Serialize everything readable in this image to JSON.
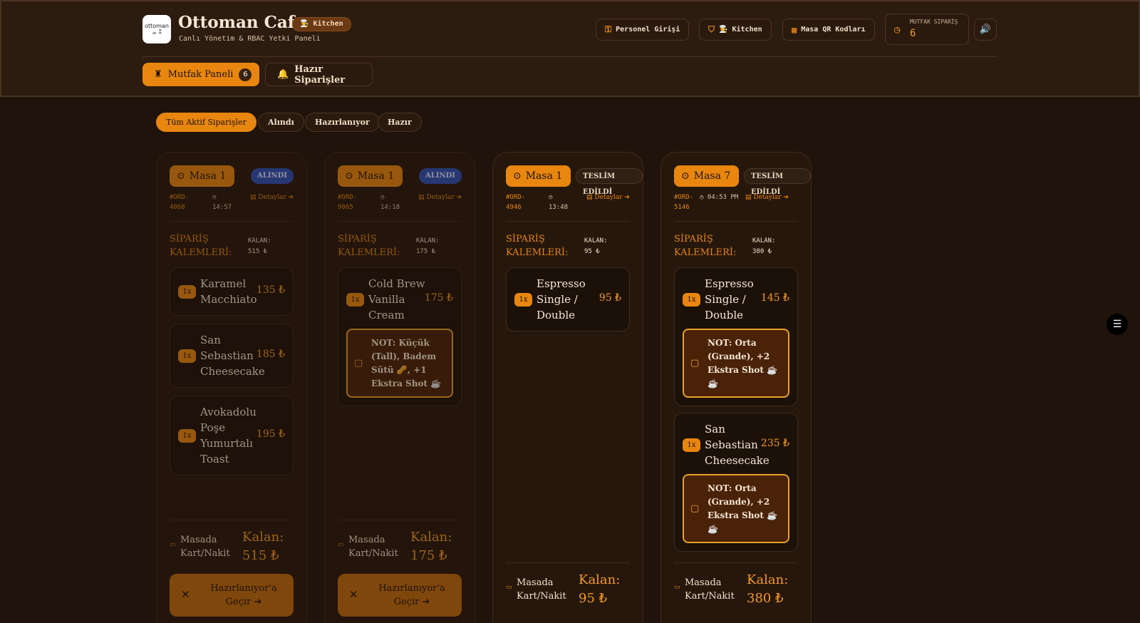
{
  "header": {
    "logo_text_top": "ottoman",
    "logo_text_bottom": "☕ ⁑",
    "app_title": "Ottoman Cafe",
    "role_badge": "👩‍🍳 Kitchen",
    "subtitle": "Canlı Yönetim & RBAC Yetki Paneli",
    "buttons": {
      "staff_login": "Personel Girişi",
      "kitchen": "👩‍🍳 Kitchen",
      "qr_codes": "Masa QR Kodları"
    },
    "counter": {
      "label": "MUTFAK SİPARİŞ",
      "value": "6"
    }
  },
  "tabs": {
    "kitchen_panel": "Mutfak Paneli",
    "kitchen_count": "6",
    "ready_orders": "Hazır Siparişler"
  },
  "filters": [
    "Tüm Aktif Siparişler",
    "Alındı",
    "Hazırlanıyor",
    "Hazır"
  ],
  "labels": {
    "items_title": "SİPARİŞ KALEMLERİ:",
    "kalan_small": "KALAN:",
    "pay_method": "Masada Kart/Nakit",
    "kalan_big": "Kalan:",
    "details": "Detaylar ➔"
  },
  "orders": [
    {
      "table": "Masa 1",
      "status": "ALINDI",
      "order_id_1": "#ORD-",
      "order_id_2": "4068",
      "time": "14:57",
      "remaining": "515 ₺",
      "items": [
        {
          "qty": "1x",
          "name": "Karamel Macchiato",
          "price": "135 ₺"
        },
        {
          "qty": "1x",
          "name": "San Sebastian Cheesecake",
          "price": "185 ₺"
        },
        {
          "qty": "1x",
          "name": "Avokadolu Poşe Yumurtalı Toast",
          "price": "195 ₺"
        }
      ],
      "action": "Hazırlanıyor'a Geçir ➔"
    },
    {
      "table": "Masa 1",
      "status": "ALINDI",
      "order_id_1": "#ORD-",
      "order_id_2": "9065",
      "time": "14:18",
      "remaining": "175 ₺",
      "items": [
        {
          "qty": "1x",
          "name": "Cold Brew Vanilla Cream",
          "price": "175 ₺",
          "note": "NOT: Küçük (Tall), Badem Sütü 🥜, +1 Ekstra Shot ☕"
        }
      ],
      "action": "Hazırlanıyor'a Geçir ➔"
    },
    {
      "table": "Masa 1",
      "status": "TESLİM EDİLDİ",
      "order_id_1": "#ORD-",
      "order_id_2": "4946",
      "time": "13:48",
      "remaining": "95 ₺",
      "items": [
        {
          "qty": "1x",
          "name": "Espresso Single / Double",
          "price": "95 ₺"
        }
      ]
    },
    {
      "table": "Masa 7",
      "status": "TESLİM EDİLDİ",
      "order_id_1": "#ORD-",
      "order_id_2": "5146",
      "time": "04:53 PM",
      "remaining": "380 ₺",
      "items": [
        {
          "qty": "1x",
          "name": "Espresso Single / Double",
          "price": "145 ₺",
          "note": "NOT: Orta (Grande), +2 Ekstra Shot ☕ ☕"
        },
        {
          "qty": "1x",
          "name": "San Sebastian Cheesecake",
          "price": "235 ₺",
          "note": "NOT: Orta (Grande), +2 Ekstra Shot ☕ ☕"
        }
      ]
    }
  ],
  "colors": {
    "accent": "#e8860f",
    "background": "#1f130b",
    "header": "#2c1b0f",
    "status_received": "#2d4fb8"
  }
}
